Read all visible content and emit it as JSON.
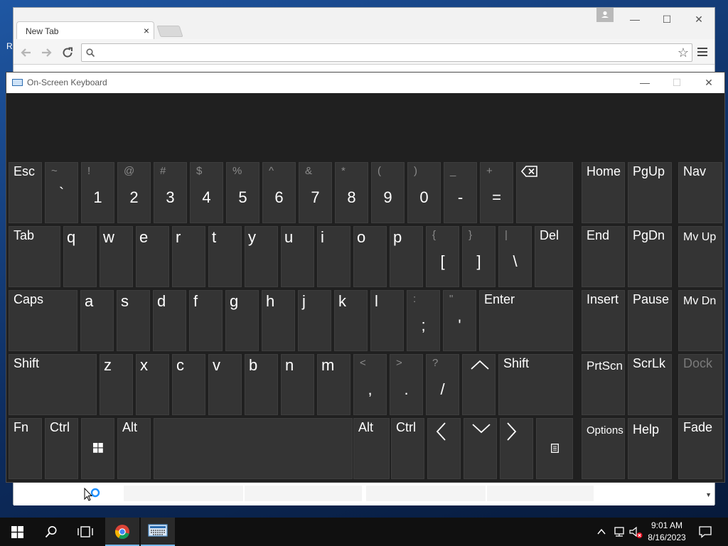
{
  "desktop": {
    "edge_text": "R"
  },
  "chrome": {
    "tab_title": "New Tab",
    "tab_close": "×",
    "address_value": "",
    "address_placeholder": "",
    "controls": {
      "minimize": "—",
      "maximize": "☐",
      "close": "✕"
    }
  },
  "osk": {
    "title": "On-Screen Keyboard",
    "controls": {
      "minimize": "—",
      "maximize": "☐",
      "close": "✕"
    },
    "rows": {
      "row1": [
        {
          "id": "esc",
          "label": "Esc"
        },
        {
          "id": "backtick",
          "sec": "~",
          "pri": "`"
        },
        {
          "id": "1",
          "sec": "!",
          "pri": "1"
        },
        {
          "id": "2",
          "sec": "@",
          "pri": "2"
        },
        {
          "id": "3",
          "sec": "#",
          "pri": "3"
        },
        {
          "id": "4",
          "sec": "$",
          "pri": "4"
        },
        {
          "id": "5",
          "sec": "%",
          "pri": "5"
        },
        {
          "id": "6",
          "sec": "^",
          "pri": "6"
        },
        {
          "id": "7",
          "sec": "&",
          "pri": "7"
        },
        {
          "id": "8",
          "sec": "*",
          "pri": "8"
        },
        {
          "id": "9",
          "sec": "(",
          "pri": "9"
        },
        {
          "id": "0",
          "sec": ")",
          "pri": "0"
        },
        {
          "id": "minus",
          "sec": "_",
          "pri": "-"
        },
        {
          "id": "equals",
          "sec": "+",
          "pri": "="
        },
        {
          "id": "backspace",
          "icon": "backspace-icon"
        },
        {
          "id": "home",
          "label": "Home"
        },
        {
          "id": "pgup",
          "label": "PgUp"
        },
        {
          "id": "nav",
          "label": "Nav"
        }
      ],
      "row2": [
        {
          "id": "tab",
          "label": "Tab"
        },
        {
          "id": "q",
          "label": "q"
        },
        {
          "id": "w",
          "label": "w"
        },
        {
          "id": "e",
          "label": "e"
        },
        {
          "id": "r",
          "label": "r"
        },
        {
          "id": "t",
          "label": "t"
        },
        {
          "id": "y",
          "label": "y"
        },
        {
          "id": "u",
          "label": "u"
        },
        {
          "id": "i",
          "label": "i"
        },
        {
          "id": "o",
          "label": "o"
        },
        {
          "id": "p",
          "label": "p"
        },
        {
          "id": "lbracket",
          "sec": "{",
          "pri": "["
        },
        {
          "id": "rbracket",
          "sec": "}",
          "pri": "]"
        },
        {
          "id": "backslash",
          "sec": "|",
          "pri": "\\"
        },
        {
          "id": "del",
          "label": "Del"
        },
        {
          "id": "end",
          "label": "End"
        },
        {
          "id": "pgdn",
          "label": "PgDn"
        },
        {
          "id": "mvup",
          "label": "Mv Up"
        }
      ],
      "row3": [
        {
          "id": "caps",
          "label": "Caps"
        },
        {
          "id": "a",
          "label": "a"
        },
        {
          "id": "s",
          "label": "s"
        },
        {
          "id": "d",
          "label": "d"
        },
        {
          "id": "f",
          "label": "f"
        },
        {
          "id": "g",
          "label": "g"
        },
        {
          "id": "h",
          "label": "h"
        },
        {
          "id": "j",
          "label": "j"
        },
        {
          "id": "k",
          "label": "k"
        },
        {
          "id": "l",
          "label": "l"
        },
        {
          "id": "semicolon",
          "sec": ":",
          "pri": ";"
        },
        {
          "id": "quote",
          "sec": "\"",
          "pri": "'"
        },
        {
          "id": "enter",
          "label": "Enter"
        },
        {
          "id": "insert",
          "label": "Insert"
        },
        {
          "id": "pause",
          "label": "Pause"
        },
        {
          "id": "mvdn",
          "label": "Mv Dn"
        }
      ],
      "row4": [
        {
          "id": "lshift",
          "label": "Shift"
        },
        {
          "id": "z",
          "label": "z"
        },
        {
          "id": "x",
          "label": "x"
        },
        {
          "id": "c",
          "label": "c"
        },
        {
          "id": "v",
          "label": "v"
        },
        {
          "id": "b",
          "label": "b"
        },
        {
          "id": "n",
          "label": "n"
        },
        {
          "id": "m",
          "label": "m"
        },
        {
          "id": "comma",
          "sec": "<",
          "pri": ","
        },
        {
          "id": "period",
          "sec": ">",
          "pri": "."
        },
        {
          "id": "slash",
          "sec": "?",
          "pri": "/"
        },
        {
          "id": "up",
          "icon": "arrow-up-icon"
        },
        {
          "id": "rshift",
          "label": "Shift"
        },
        {
          "id": "prtscn",
          "label": "PrtScn"
        },
        {
          "id": "scrlk",
          "label": "ScrLk"
        },
        {
          "id": "dock",
          "label": "Dock",
          "disabled": true
        }
      ],
      "row5": [
        {
          "id": "fn",
          "label": "Fn"
        },
        {
          "id": "lctrl",
          "label": "Ctrl"
        },
        {
          "id": "win",
          "icon": "windows-logo-icon"
        },
        {
          "id": "lalt",
          "label": "Alt"
        },
        {
          "id": "space",
          "label": ""
        },
        {
          "id": "ralt",
          "label": "Alt"
        },
        {
          "id": "rctrl",
          "label": "Ctrl"
        },
        {
          "id": "left",
          "icon": "arrow-left-icon"
        },
        {
          "id": "down",
          "icon": "arrow-down-icon"
        },
        {
          "id": "right",
          "icon": "arrow-right-icon"
        },
        {
          "id": "context",
          "icon": "context-menu-icon"
        },
        {
          "id": "options",
          "label": "Options"
        },
        {
          "id": "help",
          "label": "Help"
        },
        {
          "id": "fade",
          "label": "Fade"
        }
      ]
    }
  },
  "taskbar": {
    "time": "9:01 AM",
    "date": "8/16/2023"
  },
  "colors": {
    "key_bg": "#343434",
    "osk_bg": "#202020",
    "taskbar_bg": "#101010",
    "accent": "#76b9ed"
  }
}
